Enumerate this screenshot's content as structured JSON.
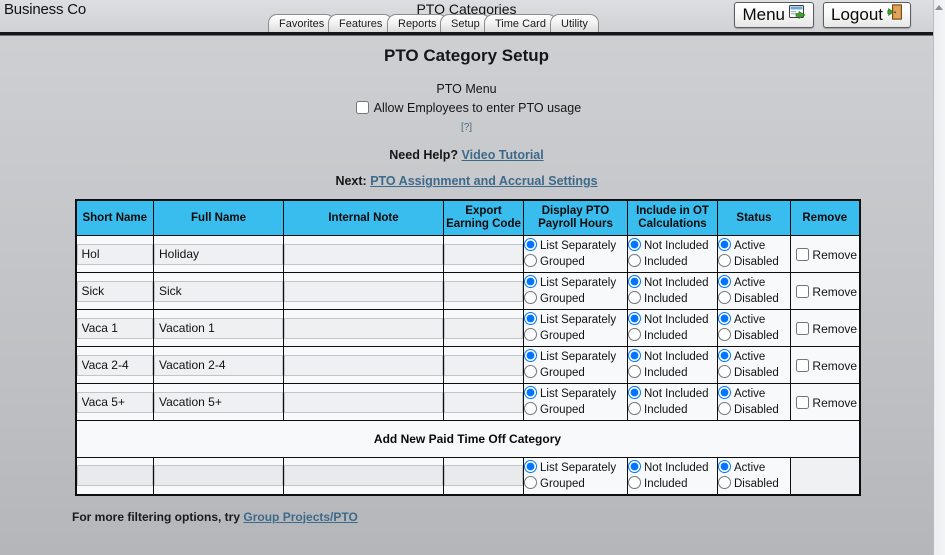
{
  "topbar": {
    "brand": "Business Co",
    "app_title": "PTO Categories",
    "tabs": [
      {
        "label": "Favorites"
      },
      {
        "label": "Features"
      },
      {
        "label": "Reports"
      },
      {
        "label": "Setup"
      },
      {
        "label": "Time Card"
      },
      {
        "label": "Utility"
      }
    ],
    "menu_label": "Menu",
    "menu_icon": "window-arrow-icon",
    "logout_label": "Logout",
    "logout_icon": "door-exit-icon"
  },
  "page": {
    "title": "PTO Category Setup",
    "pto_menu_label": "PTO Menu",
    "allow_checkbox_label": "Allow Employees to enter PTO usage",
    "allow_checkbox_checked": false,
    "help_marker": "[?]",
    "need_help_prefix": "Need Help?",
    "video_tutorial_link": "Video Tutorial",
    "next_prefix": "Next:",
    "next_link": "PTO Assignment and Accrual Settings",
    "footnote_prefix": "For more filtering options, try",
    "footnote_link": "Group Projects/PTO"
  },
  "colors": {
    "table_header_blue": "#39bdee",
    "page_background": "#c6c8cb",
    "link": "#3e6a8a",
    "border": "#0e0e0e"
  },
  "table": {
    "columns": [
      {
        "label": "Short Name"
      },
      {
        "label": "Full Name"
      },
      {
        "label": "Internal Note"
      },
      {
        "label": "Export\nEarning Code",
        "line1": "Export",
        "line2": "Earning Code"
      },
      {
        "label": "Display PTO\nPayroll Hours",
        "line1": "Display PTO",
        "line2": "Payroll Hours"
      },
      {
        "label": "Include in OT\nCalculations",
        "line1": "Include in OT",
        "line2": "Calculations"
      },
      {
        "label": "Status"
      },
      {
        "label": "Remove"
      }
    ],
    "display_options": [
      "List Separately",
      "Grouped"
    ],
    "ot_options": [
      "Not Included",
      "Included"
    ],
    "status_options": [
      "Active",
      "Disabled"
    ],
    "remove_label": "Remove",
    "add_new_banner": "Add New Paid Time Off Category",
    "rows": [
      {
        "short_name": "Hol",
        "full_name": "Holiday",
        "internal_note": "",
        "export_earning_code": "",
        "display_selected": "List Separately",
        "ot_selected": "Not Included",
        "status_selected": "Active",
        "remove_checked": false
      },
      {
        "short_name": "Sick",
        "full_name": "Sick",
        "internal_note": "",
        "export_earning_code": "",
        "display_selected": "List Separately",
        "ot_selected": "Not Included",
        "status_selected": "Active",
        "remove_checked": false
      },
      {
        "short_name": "Vaca 1",
        "full_name": "Vacation 1",
        "internal_note": "",
        "export_earning_code": "",
        "display_selected": "List Separately",
        "ot_selected": "Not Included",
        "status_selected": "Active",
        "remove_checked": false
      },
      {
        "short_name": "Vaca 2-4",
        "full_name": "Vacation 2-4",
        "internal_note": "",
        "export_earning_code": "",
        "display_selected": "List Separately",
        "ot_selected": "Not Included",
        "status_selected": "Active",
        "remove_checked": false
      },
      {
        "short_name": "Vaca 5+",
        "full_name": "Vacation 5+",
        "internal_note": "",
        "export_earning_code": "",
        "display_selected": "List Separately",
        "ot_selected": "Not Included",
        "status_selected": "Active",
        "remove_checked": false
      }
    ],
    "new_row": {
      "short_name": "",
      "full_name": "",
      "internal_note": "",
      "export_earning_code": "",
      "display_selected": "List Separately",
      "ot_selected": "Not Included",
      "status_selected": "Active"
    }
  }
}
